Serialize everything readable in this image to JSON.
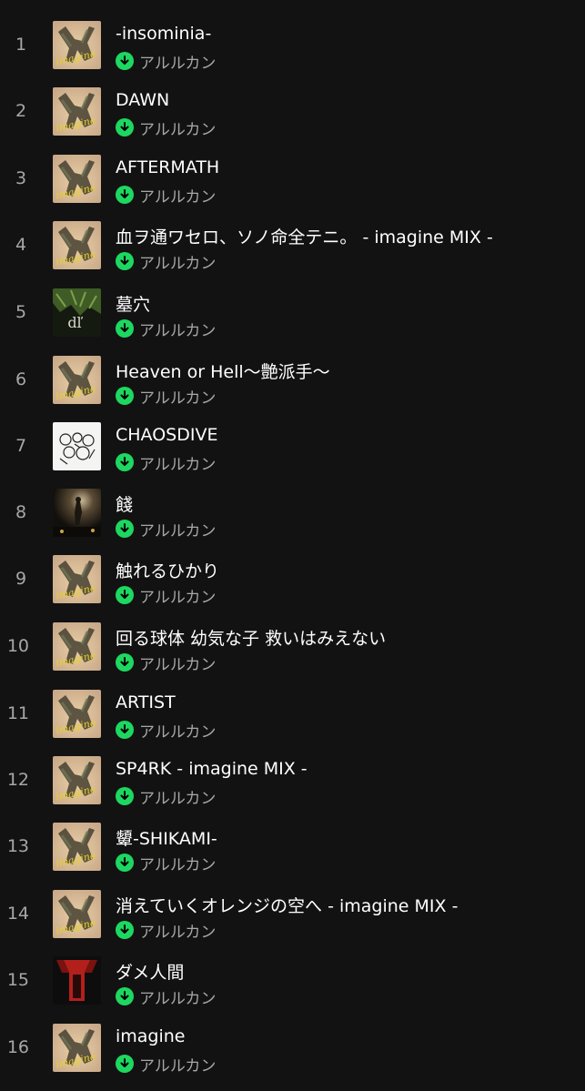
{
  "colors": {
    "background": "#121212",
    "title": "#ffffff",
    "secondary": "#a7a7a7",
    "downloaded": "#1ed760"
  },
  "tracks": [
    {
      "number": "1",
      "title": "-insominia-",
      "artist": "アルルカン",
      "artwork": "album-art-imagine-icon",
      "downloaded": true
    },
    {
      "number": "2",
      "title": "DAWN",
      "artist": "アルルカン",
      "artwork": "album-art-imagine-icon",
      "downloaded": true
    },
    {
      "number": "3",
      "title": "AFTERMATH",
      "artist": "アルルカン",
      "artwork": "album-art-imagine-icon",
      "downloaded": true
    },
    {
      "number": "4",
      "title": "血ヲ通ワセロ、ソノ命全テニ。 - imagine MIX -",
      "artist": "アルルカン",
      "artwork": "album-art-imagine-icon",
      "downloaded": true
    },
    {
      "number": "5",
      "title": "墓穴",
      "artist": "アルルカン",
      "artwork": "album-art-green-icon",
      "downloaded": true
    },
    {
      "number": "6",
      "title": "Heaven or Hell〜艶派手〜",
      "artist": "アルルカン",
      "artwork": "album-art-imagine-icon",
      "downloaded": true
    },
    {
      "number": "7",
      "title": "CHAOSDIVE",
      "artist": "アルルカン",
      "artwork": "album-art-white-icon",
      "downloaded": true
    },
    {
      "number": "8",
      "title": "餞",
      "artist": "アルルカン",
      "artwork": "album-art-dark-stage-icon",
      "downloaded": true
    },
    {
      "number": "9",
      "title": "触れるひかり",
      "artist": "アルルカン",
      "artwork": "album-art-imagine-icon",
      "downloaded": true
    },
    {
      "number": "10",
      "title": "回る球体 幼気な子 救いはみえない",
      "artist": "アルルカン",
      "artwork": "album-art-imagine-icon",
      "downloaded": true
    },
    {
      "number": "11",
      "title": "ARTIST",
      "artist": "アルルカン",
      "artwork": "album-art-imagine-icon",
      "downloaded": true
    },
    {
      "number": "12",
      "title": "SP4RK - imagine MIX -",
      "artist": "アルルカン",
      "artwork": "album-art-imagine-icon",
      "downloaded": true
    },
    {
      "number": "13",
      "title": "顰-SHIKAMI-",
      "artist": "アルルカン",
      "artwork": "album-art-imagine-icon",
      "downloaded": true
    },
    {
      "number": "14",
      "title": "消えていくオレンジの空へ - imagine MIX -",
      "artist": "アルルカン",
      "artwork": "album-art-imagine-icon",
      "downloaded": true
    },
    {
      "number": "15",
      "title": "ダメ人間",
      "artist": "アルルカン",
      "artwork": "album-art-red-black-icon",
      "downloaded": true
    },
    {
      "number": "16",
      "title": "imagine",
      "artist": "アルルカン",
      "artwork": "album-art-imagine-icon",
      "downloaded": true
    }
  ]
}
